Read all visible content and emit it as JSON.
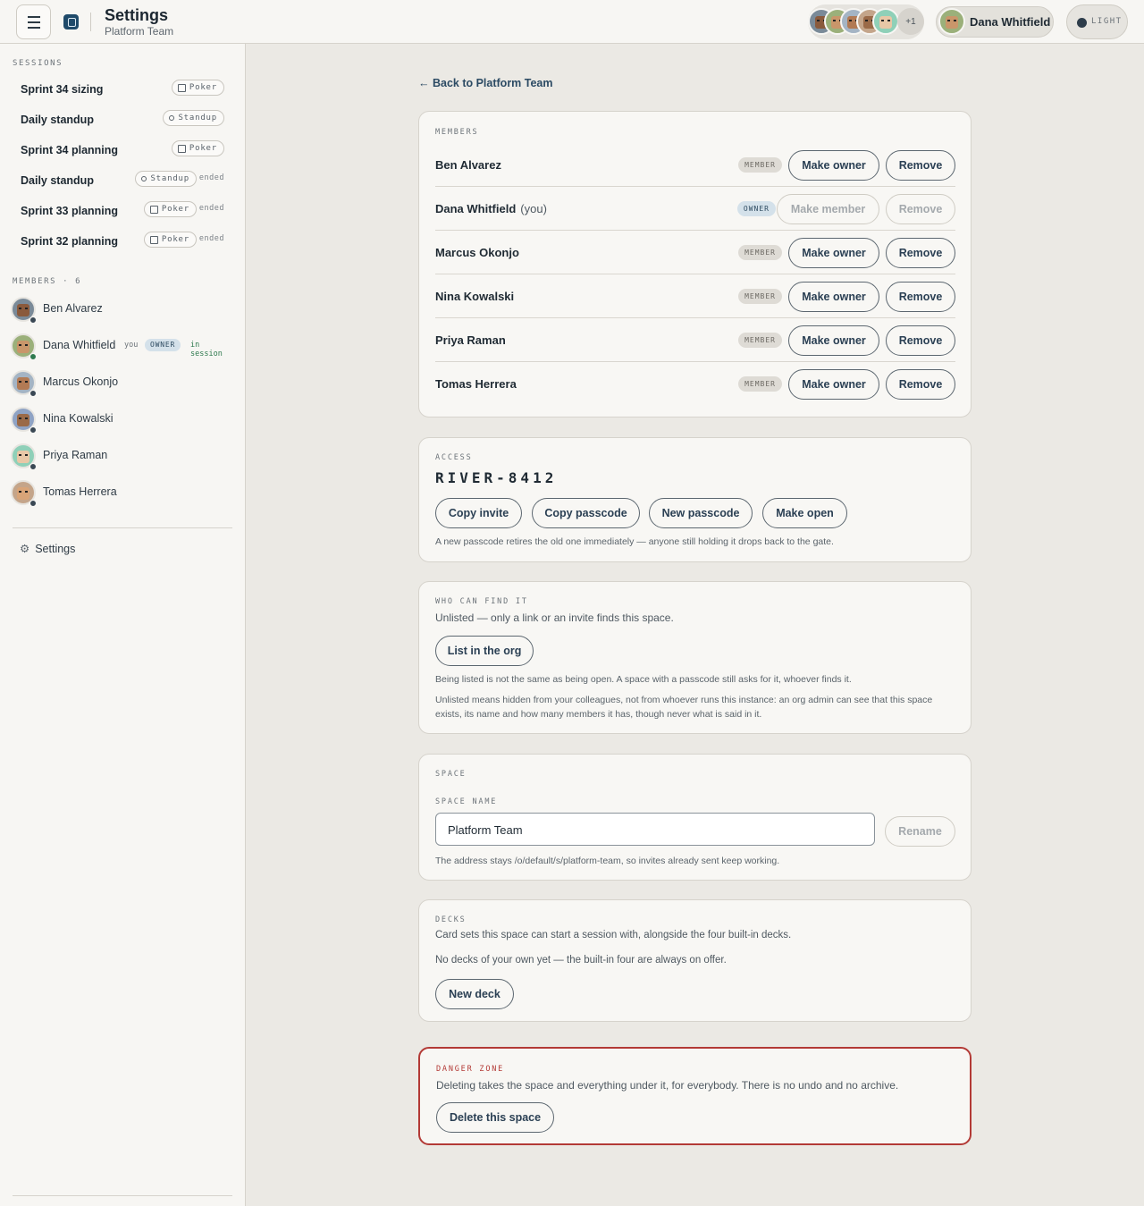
{
  "header": {
    "title": "Settings",
    "subtitle": "Platform Team",
    "avatar_overflow": "+1",
    "user_name": "Dana Whitfield",
    "theme_label": "LIGHT"
  },
  "sidebar": {
    "sessions_label": "SESSIONS",
    "sessions": [
      {
        "name": "Sprint 34 sizing",
        "type": "Poker",
        "status": ""
      },
      {
        "name": "Daily standup",
        "type": "Standup",
        "status": ""
      },
      {
        "name": "Sprint 34 planning",
        "type": "Poker",
        "status": ""
      },
      {
        "name": "Daily standup",
        "type": "Standup",
        "status": "ended"
      },
      {
        "name": "Sprint 33 planning",
        "type": "Poker",
        "status": "ended"
      },
      {
        "name": "Sprint 32 planning",
        "type": "Poker",
        "status": "ended"
      }
    ],
    "members_label": "MEMBERS · 6",
    "members": [
      {
        "name": "Ben Alvarez"
      },
      {
        "name": "Dana Whitfield",
        "you": "you",
        "role": "OWNER",
        "status": "in session"
      },
      {
        "name": "Marcus Okonjo"
      },
      {
        "name": "Nina Kowalski"
      },
      {
        "name": "Priya Raman"
      },
      {
        "name": "Tomas Herrera"
      }
    ],
    "settings_label": "Settings"
  },
  "main": {
    "back_link": "← Back to Platform Team",
    "members_card": {
      "label": "MEMBERS",
      "rows": [
        {
          "name": "Ben Alvarez",
          "you": "",
          "role": "MEMBER",
          "action": "Make owner",
          "remove": "Remove"
        },
        {
          "name": "Dana Whitfield",
          "you": "(you)",
          "role": "OWNER",
          "action": "Make member",
          "remove": "Remove"
        },
        {
          "name": "Marcus Okonjo",
          "you": "",
          "role": "MEMBER",
          "action": "Make owner",
          "remove": "Remove"
        },
        {
          "name": "Nina Kowalski",
          "you": "",
          "role": "MEMBER",
          "action": "Make owner",
          "remove": "Remove"
        },
        {
          "name": "Priya Raman",
          "you": "",
          "role": "MEMBER",
          "action": "Make owner",
          "remove": "Remove"
        },
        {
          "name": "Tomas Herrera",
          "you": "",
          "role": "MEMBER",
          "action": "Make owner",
          "remove": "Remove"
        }
      ]
    },
    "access_card": {
      "label": "ACCESS",
      "passcode": "RIVER-8412",
      "buttons": [
        "Copy invite",
        "Copy passcode",
        "New passcode",
        "Make open"
      ],
      "note": "A new passcode retires the old one immediately — anyone still holding it drops back to the gate."
    },
    "visibility_card": {
      "label": "WHO CAN FIND IT",
      "status": "Unlisted — only a link or an invite finds this space.",
      "button": "List in the org",
      "note1": "Being listed is not the same as being open. A space with a passcode still asks for it, whoever finds it.",
      "note2": "Unlisted means hidden from your colleagues, not from whoever runs this instance: an org admin can see that this space exists, its name and how many members it has, though never what is said in it."
    },
    "space_card": {
      "label": "SPACE",
      "field_label": "SPACE NAME",
      "field_value": "Platform Team",
      "button": "Rename",
      "note": "The address stays /o/default/s/platform-team, so invites already sent keep working."
    },
    "decks_card": {
      "label": "DECKS",
      "desc": "Card sets this space can start a session with, alongside the four built-in decks.",
      "empty": "No decks of your own yet — the built-in four are always on offer.",
      "button": "New deck"
    },
    "danger_card": {
      "label": "DANGER ZONE",
      "desc": "Deleting takes the space and everything under it, for everybody. There is no undo and no archive.",
      "button": "Delete this space"
    }
  },
  "colors": {
    "accent": "#2b4a63",
    "danger": "#b33a36",
    "online": "#2f7a4f",
    "background": "#ebe9e4"
  }
}
